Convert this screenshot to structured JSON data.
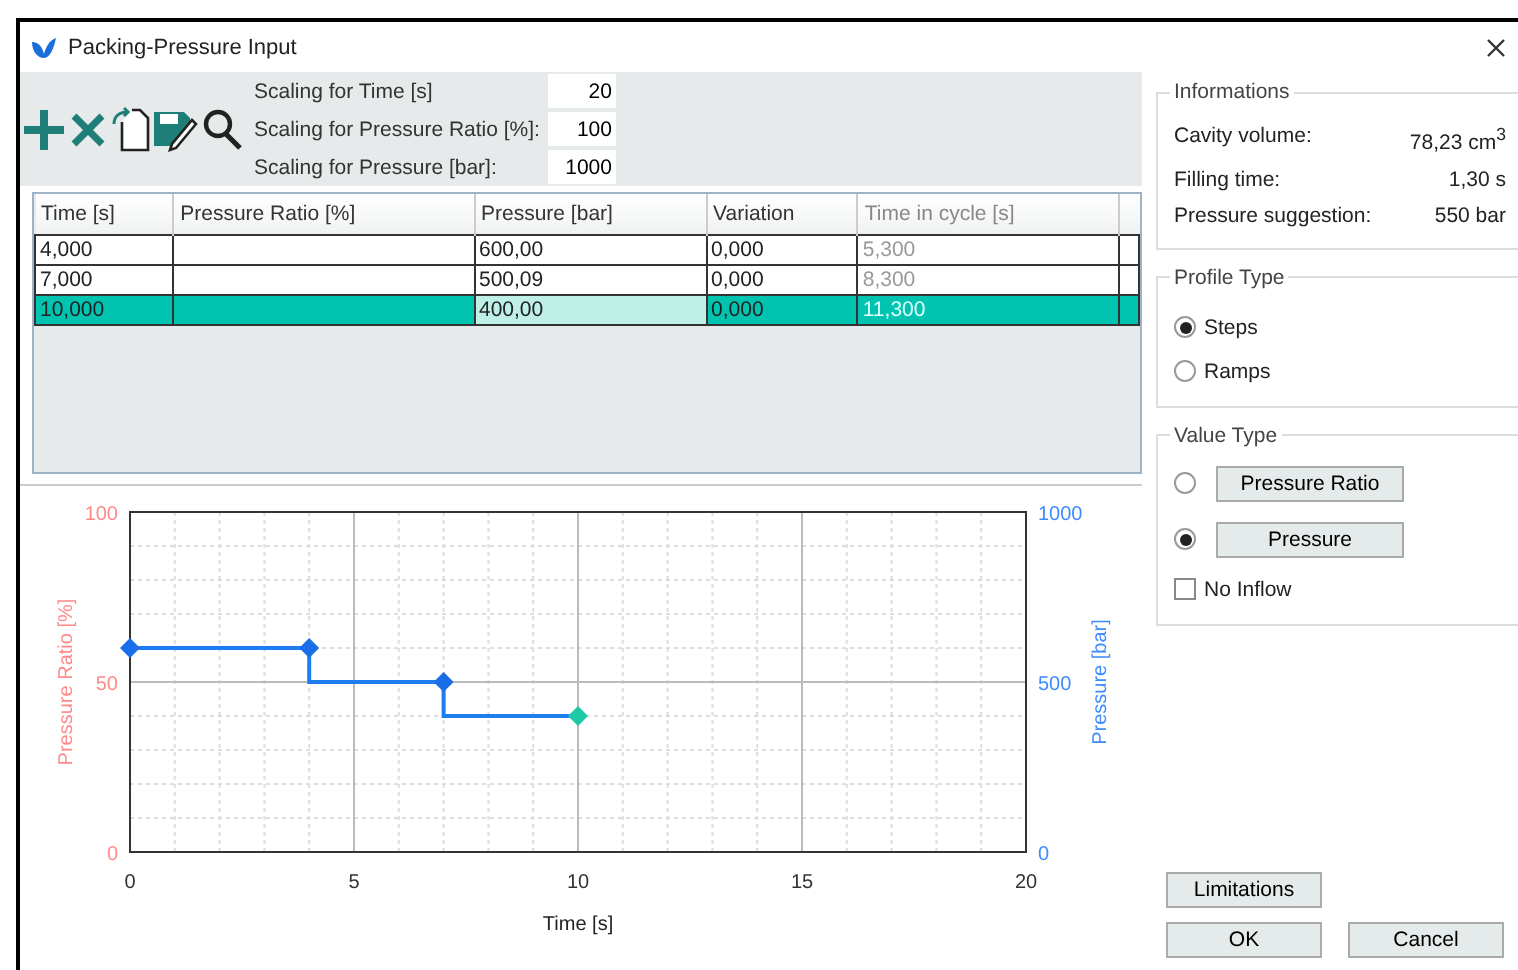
{
  "window": {
    "title": "Packing-Pressure Input"
  },
  "toolbar": {
    "scaling": [
      {
        "label": "Scaling for Time [s]",
        "value": "20"
      },
      {
        "label": "Scaling for Pressure Ratio [%]:",
        "value": "100"
      },
      {
        "label": "Scaling for Pressure [bar]:",
        "value": "1000"
      }
    ]
  },
  "table": {
    "columns": [
      {
        "label": "Time [s]",
        "disabled": false
      },
      {
        "label": "Pressure Ratio [%]",
        "disabled": false
      },
      {
        "label": "Pressure [bar]",
        "disabled": false
      },
      {
        "label": "Variation",
        "disabled": false
      },
      {
        "label": "Time in cycle [s]",
        "disabled": true
      }
    ],
    "rows": [
      {
        "selected": false,
        "cells": [
          {
            "text": "4,000",
            "editing": false
          },
          {
            "editing": false
          },
          {
            "text": "600,00",
            "editing": false
          },
          {
            "text": "0,000",
            "editing": false
          },
          {
            "text": "5,300",
            "editing": false
          }
        ]
      },
      {
        "selected": false,
        "cells": [
          {
            "text": "7,000",
            "editing": false
          },
          {
            "editing": false
          },
          {
            "text": "500,09",
            "editing": false
          },
          {
            "text": "0,000",
            "editing": false
          },
          {
            "text": "8,300",
            "editing": false
          }
        ]
      },
      {
        "selected": true,
        "cells": [
          {
            "text": "10,000",
            "editing": false
          },
          {
            "editing": false
          },
          {
            "text": "400,00",
            "editing": true
          },
          {
            "text": "0,000",
            "editing": false
          },
          {
            "text": "11,300",
            "editing": false
          }
        ]
      }
    ]
  },
  "chart": {
    "chart_data": {
      "type": "line",
      "grid": true,
      "xlabel": "Time [s]",
      "ylabel": "Pressure [bar]",
      "y2label": "Pressure Ratio [%]",
      "xlim": [
        0,
        20
      ],
      "ylim": [
        0,
        1000
      ],
      "y2lim": [
        0,
        100
      ],
      "xticks": [
        0,
        5,
        10,
        15,
        20
      ],
      "yticks": [
        0,
        500,
        1000
      ],
      "y2ticks": [
        0,
        50,
        100
      ],
      "x": [
        0,
        4,
        4,
        7,
        7,
        10
      ],
      "series": [
        {
          "color": "#1e7ef0",
          "values": [
            600,
            600,
            500,
            500,
            400,
            400
          ]
        }
      ]
    }
  },
  "informations": {
    "title": "Informations",
    "items": [
      {
        "label": "Cavity volume:",
        "value": "78,23 cm$^{3}$"
      },
      {
        "label": "Filling time:",
        "value": "1,30 s"
      },
      {
        "label": "Pressure suggestion:",
        "value": "550 bar"
      }
    ]
  },
  "profile_type": {
    "title": "Profile Type",
    "options": [
      {
        "label": "Steps",
        "selected": true
      },
      {
        "label": "Ramps",
        "selected": false
      }
    ]
  },
  "value_type": {
    "title": "Value Type",
    "options": [
      {
        "label": "Pressure Ratio",
        "selected": false
      },
      {
        "label": "Pressure",
        "selected": true
      }
    ],
    "no_inflow": {
      "label": "No Inflow",
      "checked": false
    }
  },
  "buttons": {
    "limitations": "Limitations",
    "ok": "OK",
    "cancel": "Cancel"
  }
}
